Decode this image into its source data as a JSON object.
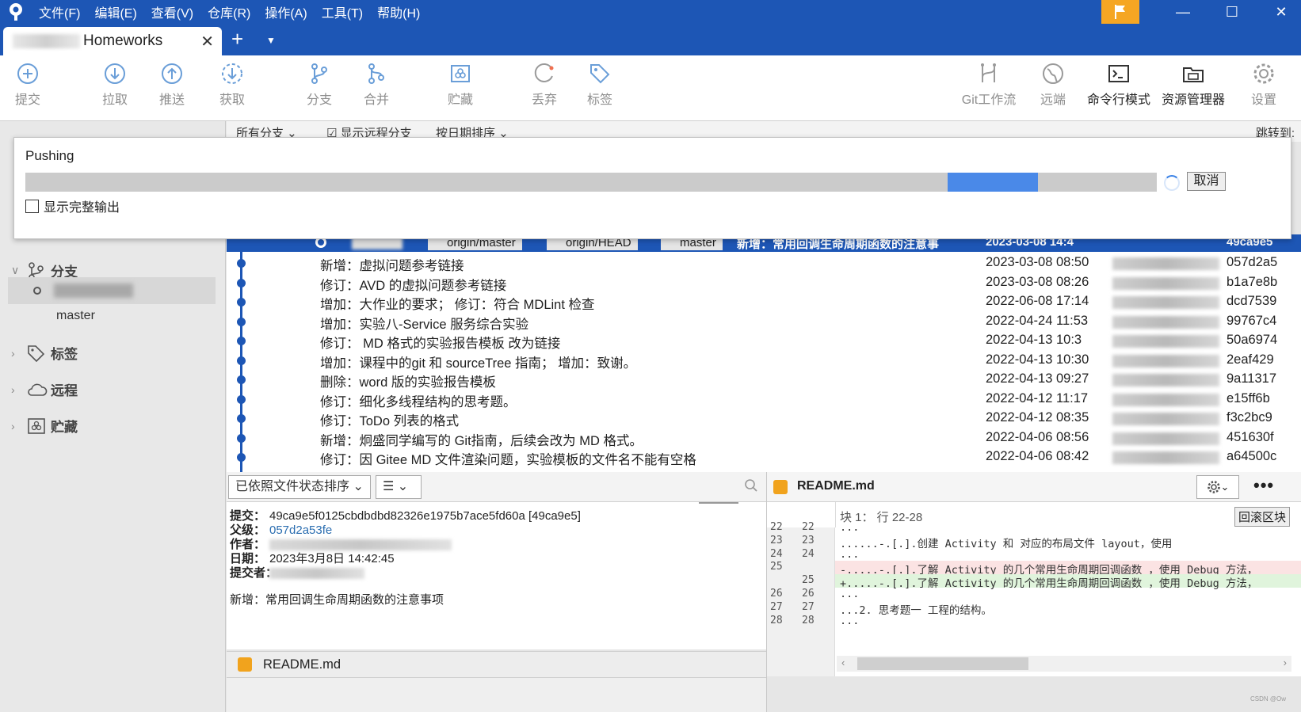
{
  "menu": [
    "文件(F)",
    "编辑(E)",
    "查看(V)",
    "仓库(R)",
    "操作(A)",
    "工具(T)",
    "帮助(H)"
  ],
  "tab": {
    "title": "Homeworks",
    "close": "✕",
    "add": "+",
    "dropdown": "⌄"
  },
  "window": {
    "minimize": "—",
    "maximize": "☐",
    "close": "✕"
  },
  "toolbar": {
    "commit": "提交",
    "pull": "拉取",
    "push": "推送",
    "fetch": "获取",
    "branch": "分支",
    "merge": "合并",
    "stash": "贮藏",
    "discard": "丢弃",
    "tag": "标签",
    "gitflow": "Git工作流",
    "remote": "远端",
    "terminal": "命令行模式",
    "explorer": "资源管理器",
    "settings": "设置"
  },
  "filter": {
    "branches": "所有分支 ⌄",
    "show_remote": "显示远程分支",
    "sort": "按日期排序 ⌄",
    "jump": "跳转到:"
  },
  "sidebar": {
    "branches": "分支",
    "branch_name": "master",
    "tags": "标签",
    "remotes": "远程",
    "stashes": "贮藏"
  },
  "dialog": {
    "title": "Pushing",
    "progress": 0.895,
    "progress_segment_width": 0.08,
    "cancel": "取消",
    "show_output": "显示完整输出"
  },
  "selected_commit": {
    "tags": [
      "origin/master",
      "origin/HEAD",
      "master"
    ],
    "message": "新增：常用回调生命周期函数的注意事",
    "date": "2023-03-08 14:4",
    "hash": "49ca9e5"
  },
  "commits": [
    {
      "msg": "新增：虚拟问题参考链接",
      "date": "2023-03-08 08:50",
      "hash": "057d2a5"
    },
    {
      "msg": "修订：AVD 的虚拟问题参考链接",
      "date": "2023-03-08 08:26",
      "hash": "b1a7e8b"
    },
    {
      "msg": "增加：大作业的要求； 修订：符合 MDLint 检查",
      "date": "2022-06-08 17:14",
      "hash": "dcd7539"
    },
    {
      "msg": "增加：实验八-Service 服务综合实验",
      "date": "2022-04-24 11:53",
      "hash": "99767c4"
    },
    {
      "msg": "修订： MD 格式的实验报告模板 改为链接",
      "date": "2022-04-13 10:3",
      "hash": "50a6974"
    },
    {
      "msg": "增加：课程中的git 和 sourceTree 指南； 增加：致谢。",
      "date": "2022-04-13 10:30",
      "hash": "2eaf429"
    },
    {
      "msg": "删除：word 版的实验报告模板",
      "date": "2022-04-13 09:27",
      "hash": "9a11317"
    },
    {
      "msg": "修订：细化多线程结构的思考题。",
      "date": "2022-04-12 11:17",
      "hash": "e15ff6b"
    },
    {
      "msg": "修订：ToDo 列表的格式",
      "date": "2022-04-12 08:35",
      "hash": "f3c2bc9"
    },
    {
      "msg": "新增：炯盛同学编写的 Git指南，后续会改为 MD 格式。",
      "date": "2022-04-06 08:56",
      "hash": "451630f"
    },
    {
      "msg": "修订：因 Gitee MD 文件渲染问题，实验模板的文件名不能有空格",
      "date": "2022-04-06 08:42",
      "hash": "a64500c"
    }
  ],
  "file_panel": {
    "sort": "已依照文件状态排序 ⌄",
    "view": "☰ ⌄"
  },
  "details": {
    "commit_label": "提交：",
    "commit": "49ca9e5f0125cbdbdbd82326e1975b7ace5fd60a [49ca9e5]",
    "parent_label": "父级：",
    "parent": "057d2a53fe",
    "author_label": "作者：",
    "date_label": "日期：",
    "date": "2023年3月8日 14:42:45",
    "committer_label": "提交者：",
    "message": "新增：常用回调生命周期函数的注意事项"
  },
  "file_name": "README.md",
  "diff": {
    "file": "README.md",
    "hunk": "块 1： 行 22-28",
    "revert_hunk": "回滚区块",
    "lines": [
      {
        "old": "22",
        "new": "22",
        "text": "..."
      },
      {
        "old": "23",
        "new": "23",
        "text": "......-.[.].创建 Activity 和 对应的布局文件 layout，使用"
      },
      {
        "old": "24",
        "new": "24",
        "text": "..."
      },
      {
        "old": "25",
        "new": "",
        "text": "-.....-.[.].了解 Activity 的几个常用生命周期回调函数 ，使用 Debug 方法，",
        "type": "del"
      },
      {
        "old": "",
        "new": "25",
        "text": "+.....-.[.].了解 Activity 的几个常用生命周期回调函数 ，使用 Debug 方法，",
        "type": "add"
      },
      {
        "old": "26",
        "new": "26",
        "text": "..."
      },
      {
        "old": "27",
        "new": "27",
        "text": "...2. 思考题一                工程的结构。"
      },
      {
        "old": "28",
        "new": "28",
        "text": "..."
      }
    ]
  },
  "watermark": "CSDN @Ow",
  "colors": {
    "brand": "#1d56b5",
    "flag": "#f5a623",
    "progress": "#4a89e8"
  }
}
